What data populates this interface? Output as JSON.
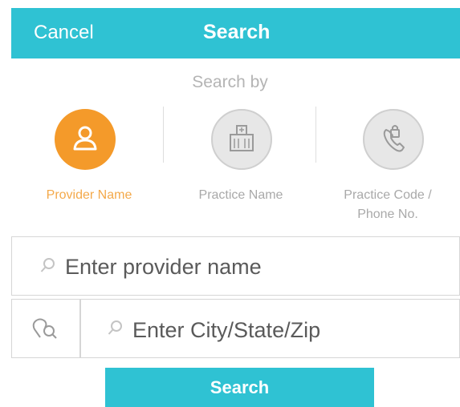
{
  "header": {
    "cancel_label": "Cancel",
    "title": "Search"
  },
  "search_by": {
    "label": "Search by",
    "options": [
      {
        "label": "Provider Name",
        "icon": "person-icon",
        "selected": true
      },
      {
        "label": "Practice Name",
        "icon": "building-icon",
        "selected": false
      },
      {
        "label": "Practice Code / Phone No.",
        "label_line1": "Practice Code /",
        "label_line2": "Phone No.",
        "icon": "lock-phone-icon",
        "selected": false
      }
    ]
  },
  "provider_search": {
    "placeholder": "Enter provider name",
    "value": "",
    "icon": "search-icon"
  },
  "location_search": {
    "placeholder": "Enter City/State/Zip",
    "value": "",
    "icon": "search-icon",
    "locate_icon": "location-search-icon"
  },
  "search_button": {
    "label": "Search"
  },
  "colors": {
    "accent": "#2fc2d3",
    "selected": "#f49a2a",
    "muted": "#a9a9a9"
  }
}
